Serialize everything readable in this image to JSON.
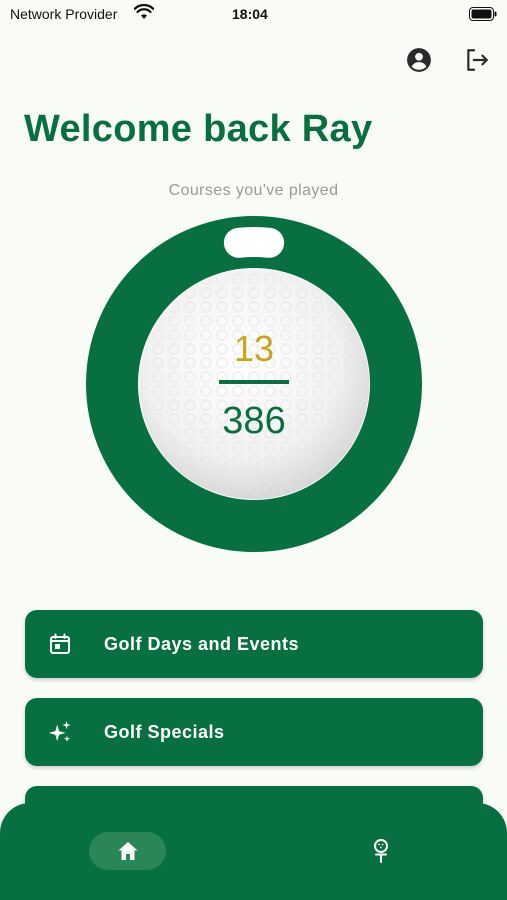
{
  "status_bar": {
    "carrier": "Network Provider",
    "time": "18:04",
    "wifi_icon": "wifi-icon",
    "battery_icon": "battery-icon"
  },
  "header": {
    "profile_icon": "account-circle-icon",
    "logout_icon": "logout-icon"
  },
  "welcome": {
    "title": "Welcome back Ray",
    "caption": "Courses you've played"
  },
  "courses": {
    "played": "13",
    "total": "386",
    "progress_fraction": 0.034
  },
  "menu": [
    {
      "label": "Golf Days and Events",
      "icon": "calendar-icon"
    },
    {
      "label": "Golf Specials",
      "icon": "sparkles-icon"
    }
  ],
  "bottom_nav": {
    "items": [
      {
        "icon": "home-icon",
        "selected": true
      },
      {
        "icon": "golf-tee-icon",
        "selected": false
      }
    ]
  },
  "colors": {
    "primary": "#087040",
    "accent_gold": "#c8a61a",
    "background": "#f8fbf6",
    "caption_gray": "#9a9a9a"
  }
}
